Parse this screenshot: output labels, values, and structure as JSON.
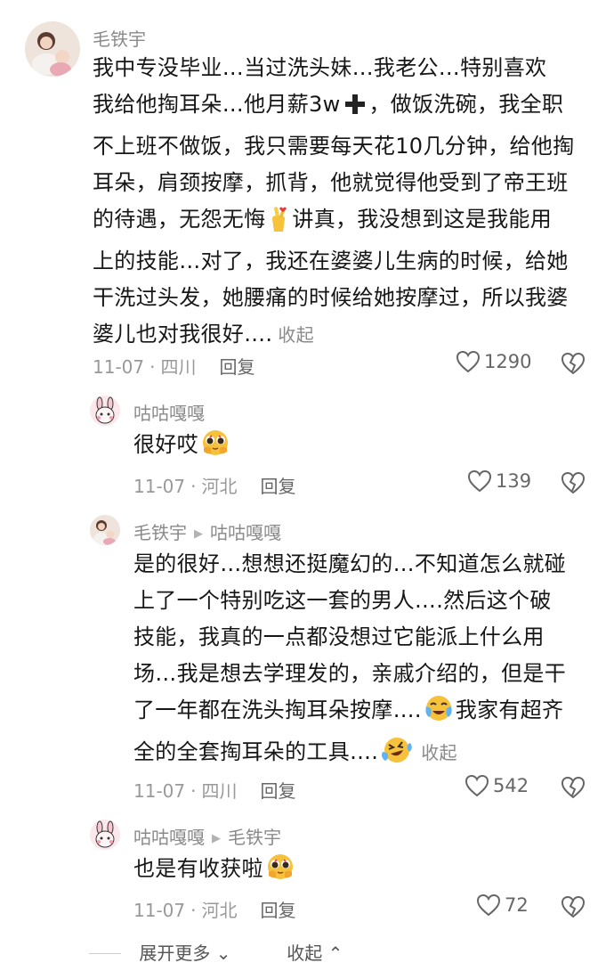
{
  "comments": [
    {
      "author": "毛铁宇",
      "reply_to": "",
      "lines": [
        "我中专没毕业…当过洗头妹…我老公…特别喜欢",
        "我给他掏耳朵…他月薪3w",
        "，做饭洗碗，我全职",
        "不上班不做饭，我只需要每天花10几分钟，给他掏",
        "耳朵，肩颈按摩，抓背，他就觉得他受到了帝王班",
        "的待遇，无怨无悔",
        "讲真，我没想到这是我能用",
        "上的技能…对了，我还在婆婆儿生病的时候，给她",
        "干洗过头发，她腰痛的时候给她按摩过，所以我婆",
        "婆儿也对我很好…."
      ],
      "collapse": "收起",
      "date": "11-07",
      "location": "四川",
      "reply": "回复",
      "likes": "1290"
    },
    {
      "author": "咕咕嘎嘎",
      "reply_to": "",
      "text": "很好哎",
      "date": "11-07",
      "location": "河北",
      "reply": "回复",
      "likes": "139"
    },
    {
      "author": "毛铁宇",
      "reply_to": "咕咕嘎嘎",
      "lines": [
        "是的很好…想想还挺魔幻的…不知道怎么就碰",
        "上了一个特别吃这一套的男人….然后这个破",
        "技能，我真的一点都没想过它能派上什么用",
        "场…我是想去学理发的，亲戚介绍的，但是干",
        "了一年都在洗头掏耳朵按摩….",
        "我家有超齐",
        "全的全套掏耳朵的工具…."
      ],
      "collapse": "收起",
      "date": "11-07",
      "location": "四川",
      "reply": "回复",
      "likes": "542"
    },
    {
      "author": "咕咕嘎嘎",
      "reply_to": "毛铁宇",
      "text": "也是有收获啦",
      "date": "11-07",
      "location": "河北",
      "reply": "回复",
      "likes": "72"
    }
  ],
  "footer": {
    "expand_more": "展开更多",
    "collapse": "收起"
  },
  "icons": {
    "plus": "plus-emoji-icon",
    "heart_hands": "finger-heart-emoji-icon",
    "pleading": "pleading-face-emoji-icon",
    "cry_laugh": "crying-emoji-icon",
    "like": "heart-outline-icon",
    "dislike": "broken-heart-icon"
  }
}
